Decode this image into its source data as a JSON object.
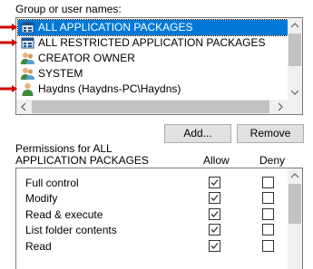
{
  "group_label": "Group or user names:",
  "users": [
    {
      "name": "ALL APPLICATION PACKAGES",
      "icon": "app-package-icon",
      "selected": true
    },
    {
      "name": "ALL RESTRICTED APPLICATION PACKAGES",
      "icon": "app-package-icon",
      "selected": false
    },
    {
      "name": "CREATOR OWNER",
      "icon": "user-group-icon",
      "selected": false
    },
    {
      "name": "SYSTEM",
      "icon": "user-group-icon",
      "selected": false
    },
    {
      "name": "Haydns (Haydns-PC\\Haydns)",
      "icon": "user-icon",
      "selected": false
    }
  ],
  "buttons": {
    "add": "Add...",
    "remove": "Remove"
  },
  "permissions": {
    "label_line1": "Permissions for ALL",
    "label_line2": "APPLICATION PACKAGES",
    "allow_header": "Allow",
    "deny_header": "Deny",
    "rows": [
      {
        "name": "Full control",
        "allow": true,
        "deny": false
      },
      {
        "name": "Modify",
        "allow": true,
        "deny": false
      },
      {
        "name": "Read & execute",
        "allow": true,
        "deny": false
      },
      {
        "name": "List folder contents",
        "allow": true,
        "deny": false
      },
      {
        "name": "Read",
        "allow": true,
        "deny": false
      }
    ]
  },
  "colors": {
    "selection": "#0078d7",
    "annotation_arrow": "#d00000"
  }
}
